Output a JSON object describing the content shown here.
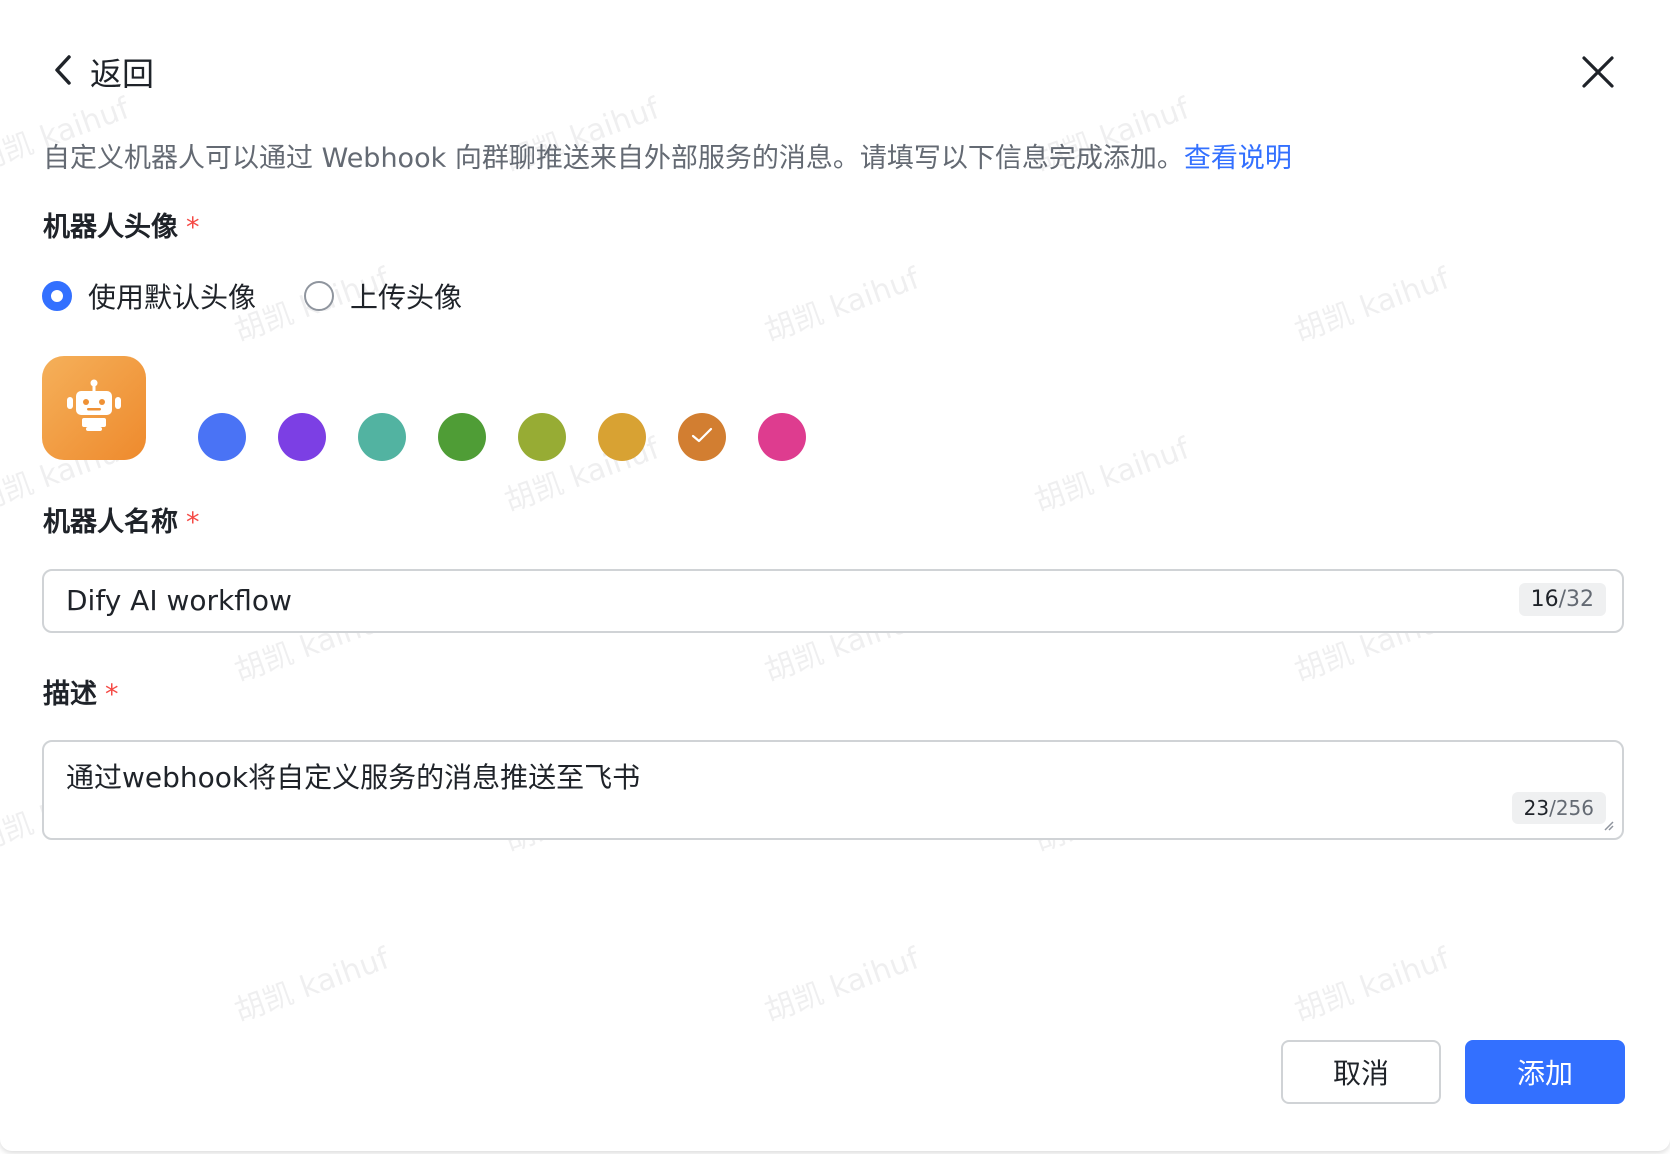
{
  "header": {
    "back_label": "返回"
  },
  "intro": {
    "text": "自定义机器人可以通过 Webhook 向群聊推送来自外部服务的消息。请填写以下信息完成添加。",
    "link_text": "查看说明"
  },
  "avatar_section": {
    "label": "机器人头像",
    "required_mark": "*",
    "options": [
      {
        "label": "使用默认头像",
        "selected": true
      },
      {
        "label": "上传头像",
        "selected": false
      }
    ],
    "colors": [
      "#4a73f5",
      "#7c3fe4",
      "#52b3a1",
      "#4f9d36",
      "#97ac34",
      "#d8a233",
      "#d27e31",
      "#de3c8f"
    ],
    "selected_color_index": 6
  },
  "name_section": {
    "label": "机器人名称",
    "required_mark": "*",
    "value": "Dify AI workflow",
    "count": "16",
    "max": "/32"
  },
  "desc_section": {
    "label": "描述",
    "required_mark": "*",
    "value": "通过webhook将自定义服务的消息推送至飞书",
    "count": "23",
    "max": "/256"
  },
  "footer": {
    "cancel_label": "取消",
    "add_label": "添加"
  },
  "watermark": {
    "text": "胡凯 kaihuf"
  },
  "colors": {
    "primary": "#3370ff",
    "required": "#f54a45"
  }
}
